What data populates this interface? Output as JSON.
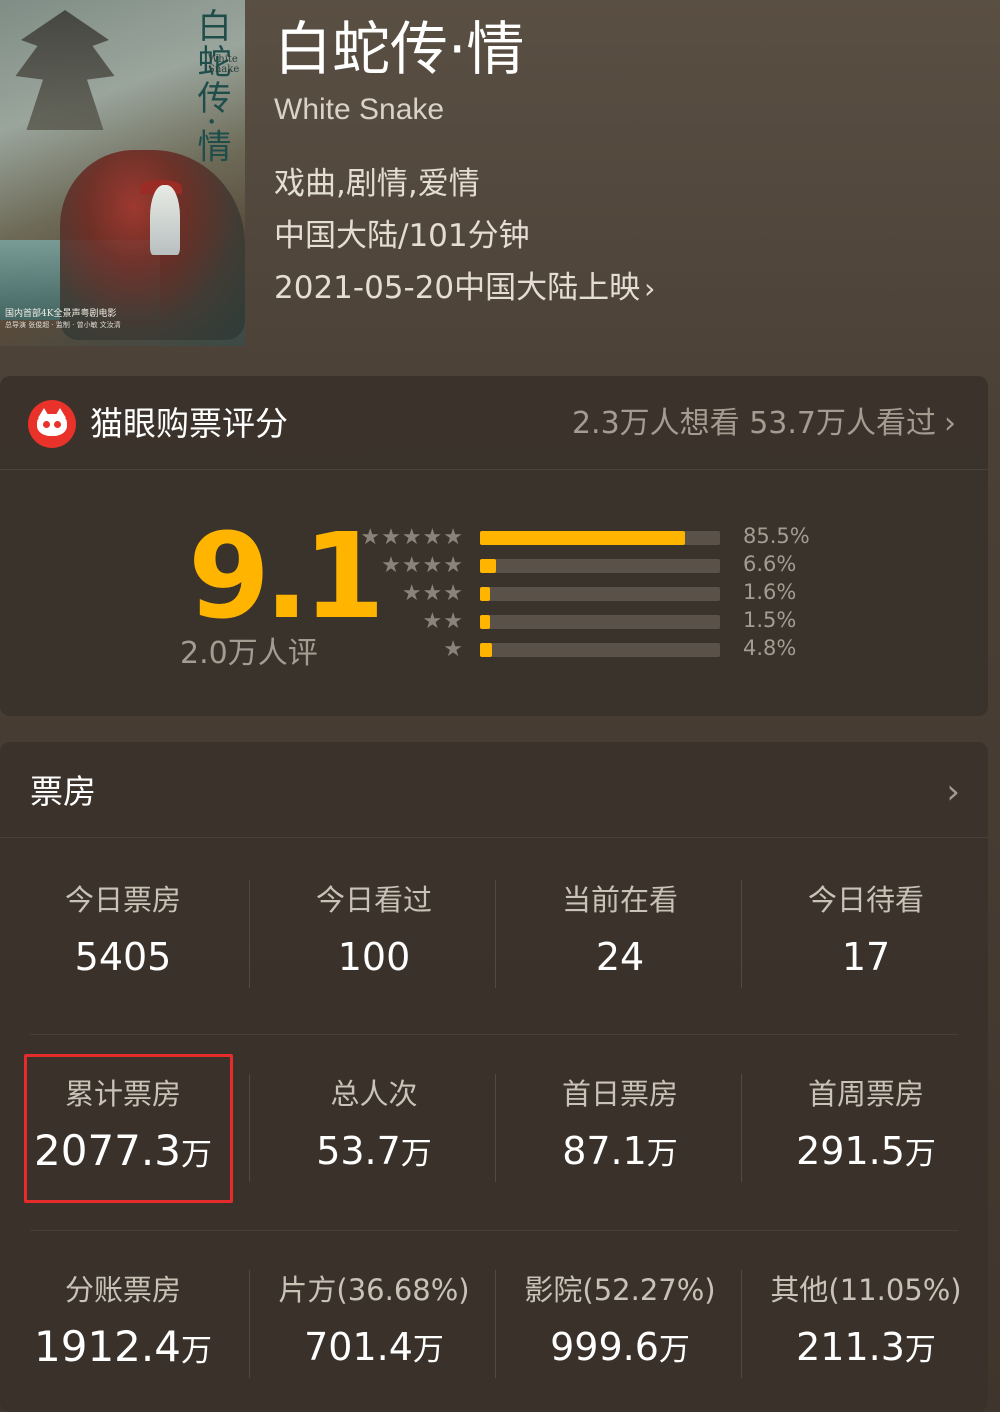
{
  "movie": {
    "poster": {
      "title": "白蛇传·情",
      "subtitle": "White Snake",
      "caption": "国内首部4K全景声粤剧电影",
      "caption_small": "总导演 张俊超 · 监制 · 曾小敏 文汝清"
    },
    "title": "白蛇传·情",
    "subtitle": "White Snake",
    "genre": "戏曲,剧情,爱情",
    "region_duration": "中国大陆/101分钟",
    "release": "2021-05-20中国大陆上映"
  },
  "rating": {
    "header_title": "猫眼购票评分",
    "want_watched": "2.3万人想看 53.7万人看过",
    "score": "9.1",
    "rater_count": "2.0万人评",
    "accent_color": "#ffb400",
    "distribution": [
      {
        "stars": "★★★★★",
        "pct": "85.5%",
        "value": 85.5
      },
      {
        "stars": "★★★★",
        "pct": "6.6%",
        "value": 6.6
      },
      {
        "stars": "★★★",
        "pct": "1.6%",
        "value": 1.6
      },
      {
        "stars": "★★",
        "pct": "1.5%",
        "value": 1.5
      },
      {
        "stars": "★",
        "pct": "4.8%",
        "value": 4.8
      }
    ]
  },
  "box_office": {
    "title": "票房",
    "highlight_color": "#e62b2b",
    "rows": [
      [
        {
          "label": "今日票房",
          "value": "5405",
          "unit": ""
        },
        {
          "label": "今日看过",
          "value": "100",
          "unit": ""
        },
        {
          "label": "当前在看",
          "value": "24",
          "unit": ""
        },
        {
          "label": "今日待看",
          "value": "17",
          "unit": ""
        }
      ],
      [
        {
          "label": "累计票房",
          "value": "2077.3",
          "unit": "万"
        },
        {
          "label": "总人次",
          "value": "53.7",
          "unit": "万"
        },
        {
          "label": "首日票房",
          "value": "87.1",
          "unit": "万"
        },
        {
          "label": "首周票房",
          "value": "291.5",
          "unit": "万"
        }
      ],
      [
        {
          "label": "分账票房",
          "value": "1912.4",
          "unit": "万"
        },
        {
          "label": "片方(36.68%)",
          "value": "701.4",
          "unit": "万"
        },
        {
          "label": "影院(52.27%)",
          "value": "999.6",
          "unit": "万"
        },
        {
          "label": "其他(11.05%)",
          "value": "211.3",
          "unit": "万"
        }
      ]
    ]
  },
  "icons": {
    "chevron": "›"
  }
}
